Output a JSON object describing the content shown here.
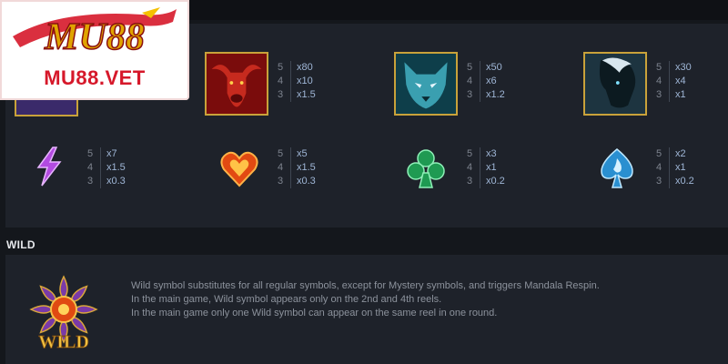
{
  "logo": {
    "brand": "MU88",
    "url": "MU88.VET"
  },
  "paytable": {
    "high_symbols": [
      {
        "name": "bull",
        "pays": [
          [
            "5",
            "x80"
          ],
          [
            "4",
            "x10"
          ],
          [
            "3",
            "x1.5"
          ]
        ]
      },
      {
        "name": "wolf",
        "pays": [
          [
            "5",
            "x50"
          ],
          [
            "4",
            "x6"
          ],
          [
            "3",
            "x1.2"
          ]
        ]
      },
      {
        "name": "horse",
        "pays": [
          [
            "5",
            "x30"
          ],
          [
            "4",
            "x4"
          ],
          [
            "3",
            "x1"
          ]
        ]
      }
    ],
    "low_symbols": [
      {
        "name": "purple-gem",
        "pays": [
          [
            "5",
            "x7"
          ],
          [
            "4",
            "x1.5"
          ],
          [
            "3",
            "x0.3"
          ]
        ]
      },
      {
        "name": "heart-gem",
        "pays": [
          [
            "5",
            "x5"
          ],
          [
            "4",
            "x1.5"
          ],
          [
            "3",
            "x0.3"
          ]
        ]
      },
      {
        "name": "club-gem",
        "pays": [
          [
            "5",
            "x3"
          ],
          [
            "4",
            "x1"
          ],
          [
            "3",
            "x0.2"
          ]
        ]
      },
      {
        "name": "spade-gem",
        "pays": [
          [
            "5",
            "x2"
          ],
          [
            "4",
            "x1"
          ],
          [
            "3",
            "x0.2"
          ]
        ]
      }
    ]
  },
  "wild": {
    "title": "WILD",
    "icon_label": "WILD",
    "lines": [
      "Wild symbol substitutes for all regular symbols, except for Mystery symbols, and triggers Mandala Respin.",
      "In the main game, Wild symbol appears only on the 2nd and 4th reels.",
      "In the main game only one Wild symbol can appear on the same reel in one round."
    ]
  },
  "colors": {
    "accent_gold": "#c9a23a",
    "multiplier": "#9fb6d6",
    "logo_red": "#d6182a"
  }
}
